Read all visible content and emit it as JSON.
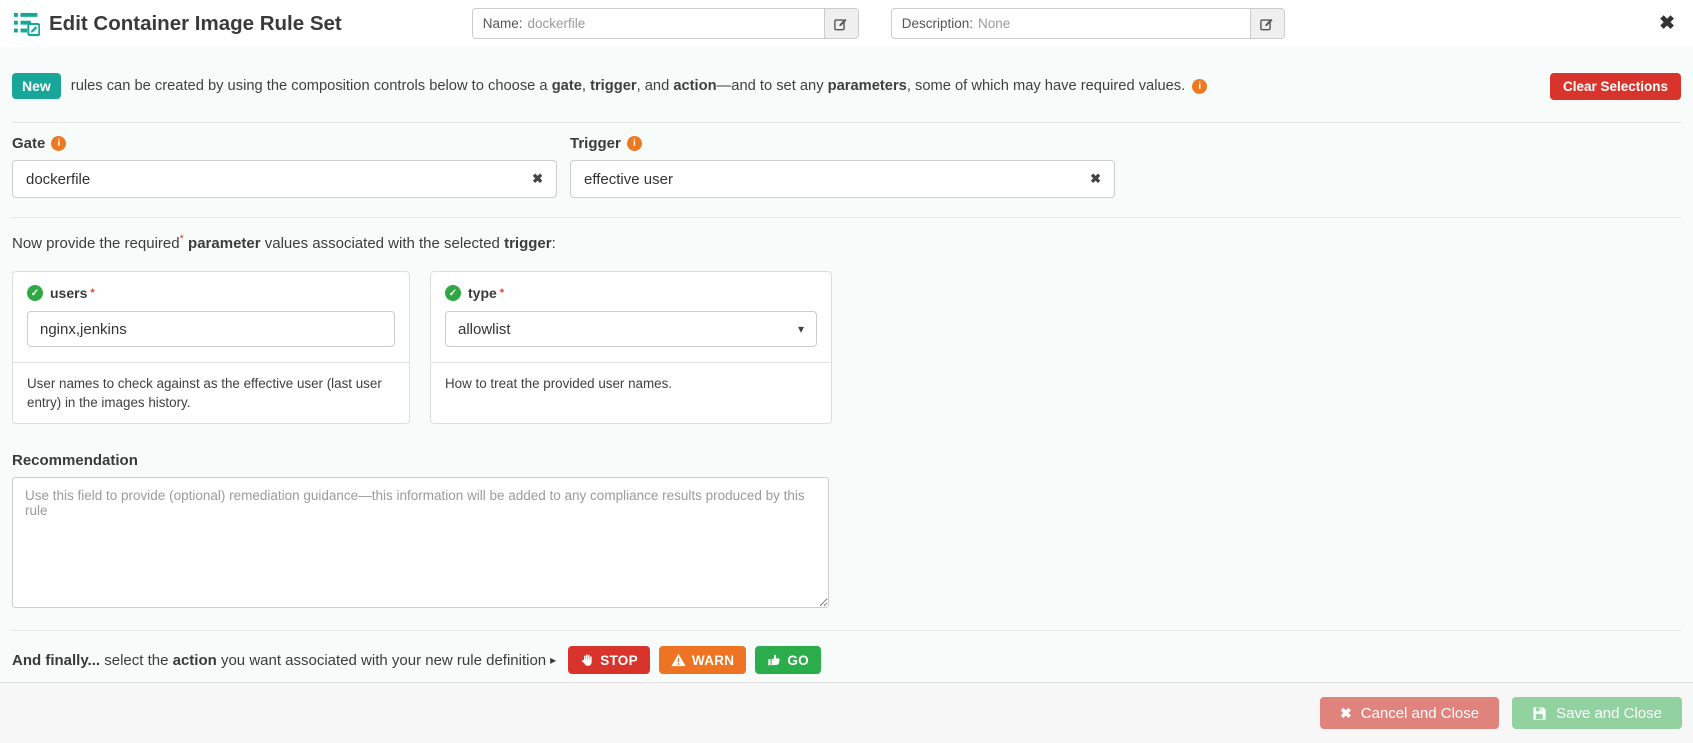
{
  "header": {
    "title": "Edit Container Image Rule Set",
    "name_field": {
      "label": "Name:",
      "value": "dockerfile"
    },
    "description_field": {
      "label": "Description:",
      "value": "None"
    }
  },
  "icons": {
    "close": "✖",
    "clear": "✖",
    "caret_down": "▾",
    "check": "✓",
    "info": "i",
    "cancel_x": "✖"
  },
  "intro": {
    "badge": "New",
    "segments": {
      "s1": "rules can be created by using the composition controls below to choose a ",
      "gate": "gate",
      "s2": ", ",
      "trigger": "trigger",
      "s3": ", and ",
      "action": "action",
      "s4": "—and to set any ",
      "parameters": "parameters",
      "s5": ", some of which may have required values."
    },
    "clear_button": "Clear Selections"
  },
  "gate": {
    "label": "Gate",
    "value": "dockerfile"
  },
  "trigger": {
    "label": "Trigger",
    "value": "effective user"
  },
  "params_intro": {
    "s1": "Now provide the required",
    "asterisk": "*",
    "s2": " ",
    "b1": "parameter",
    "s3": " values associated with the selected ",
    "b2": "trigger",
    "s4": ":"
  },
  "parameters": [
    {
      "name": "users",
      "required_mark": "*",
      "value": "nginx,jenkins",
      "description": "User names to check against as the effective user (last user entry) in the images history."
    },
    {
      "name": "type",
      "required_mark": "*",
      "value": "allowlist",
      "description": "How to treat the provided user names."
    }
  ],
  "recommendation": {
    "label": "Recommendation",
    "placeholder": "Use this field to provide (optional) remediation guidance—this information will be added to any compliance results produced by this rule"
  },
  "actions": {
    "b1": "And finally...",
    "s1": " select the ",
    "b2": "action",
    "s2": " you want associated with your new rule definition ",
    "pointer": "▸",
    "buttons": [
      {
        "label": "STOP",
        "color": "#d9342c",
        "icon": "hand-stop-icon"
      },
      {
        "label": "WARN",
        "color": "#ee7423",
        "icon": "warning-triangle-icon"
      },
      {
        "label": "GO",
        "color": "#2cad4c",
        "icon": "thumbs-up-icon"
      }
    ]
  },
  "footer": {
    "cancel_label": "Cancel and Close",
    "save_label": "Save and Close"
  },
  "colors": {
    "accent_teal": "#17a697",
    "danger_red": "#d9342c",
    "warn_orange": "#ee7423",
    "go_green": "#2cad4c",
    "info_orange": "#f0781f",
    "check_green": "#2ea843",
    "cancel_muted_red": "#e0837d",
    "save_muted_green": "#92d2a1",
    "page_tint": "#f7fcfb"
  }
}
